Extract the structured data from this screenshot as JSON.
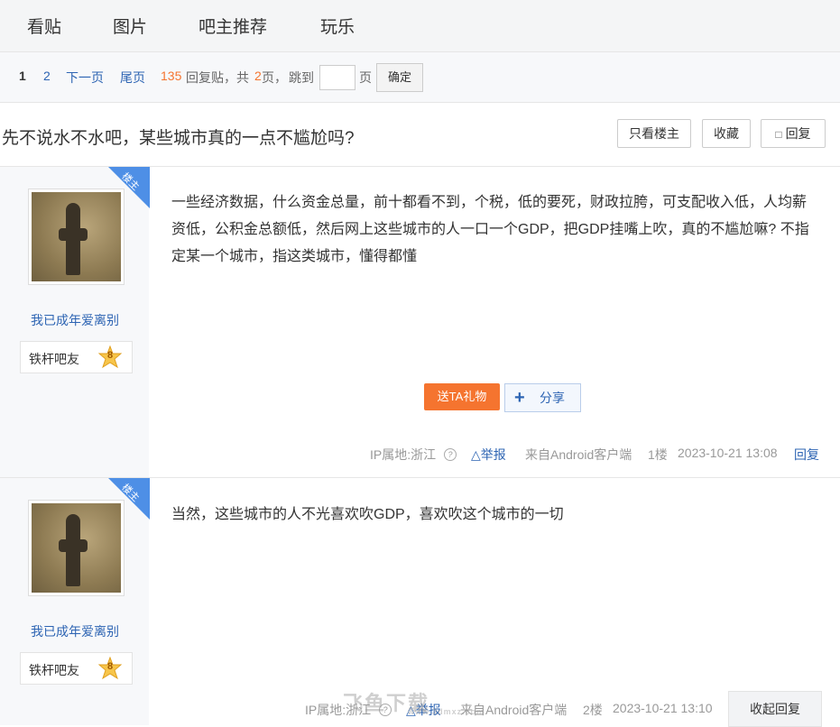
{
  "nav": {
    "tabs": [
      "看贴",
      "图片",
      "吧主推荐",
      "玩乐"
    ]
  },
  "pager": {
    "current": "1",
    "page2": "2",
    "next": "下一页",
    "last": "尾页",
    "reply_count": "135",
    "reply_label": "回复贴，共",
    "pages": "2",
    "pages_suffix": "页，",
    "jump": "跳到",
    "page_unit": "页",
    "confirm": "确定"
  },
  "thread": {
    "title": "先不说水不水吧，某些城市真的一点不尴尬吗?",
    "only_op": "只看楼主",
    "favorite": "收藏",
    "reply": "回复"
  },
  "posts": [
    {
      "op_tag": "楼主",
      "username": "我已成年爱离别",
      "level_title": "铁杆吧友",
      "level": "8",
      "content": "一些经济数据，什么资金总量，前十都看不到，个税，低的要死，财政拉胯，可支配收入低，人均薪资低，公积金总额低，然后网上这些城市的人一口一个GDP，把GDP挂嘴上吹，真的不尴尬嘛? 不指定某一个城市，指这类城市，懂得都懂",
      "gift": "送TA礼物",
      "share": "分享",
      "ip": "IP属地:浙江",
      "report": "举报",
      "source": "来自Android客户端",
      "floor": "1楼",
      "time": "2023-10-21 13:08",
      "reply": "回复"
    },
    {
      "op_tag": "楼主",
      "username": "我已成年爱离别",
      "level_title": "铁杆吧友",
      "level": "8",
      "content": "当然，这些城市的人不光喜欢吹GDP，喜欢吹这个城市的一切",
      "ip": "IP属地:浙江",
      "report": "举报",
      "source": "来自Android客户端",
      "floor": "2楼",
      "time": "2023-10-21 13:10",
      "collapse": "收起回复"
    }
  ],
  "watermark": {
    "text": "飞鱼下载",
    "sub": "www.3dmxz.com"
  }
}
